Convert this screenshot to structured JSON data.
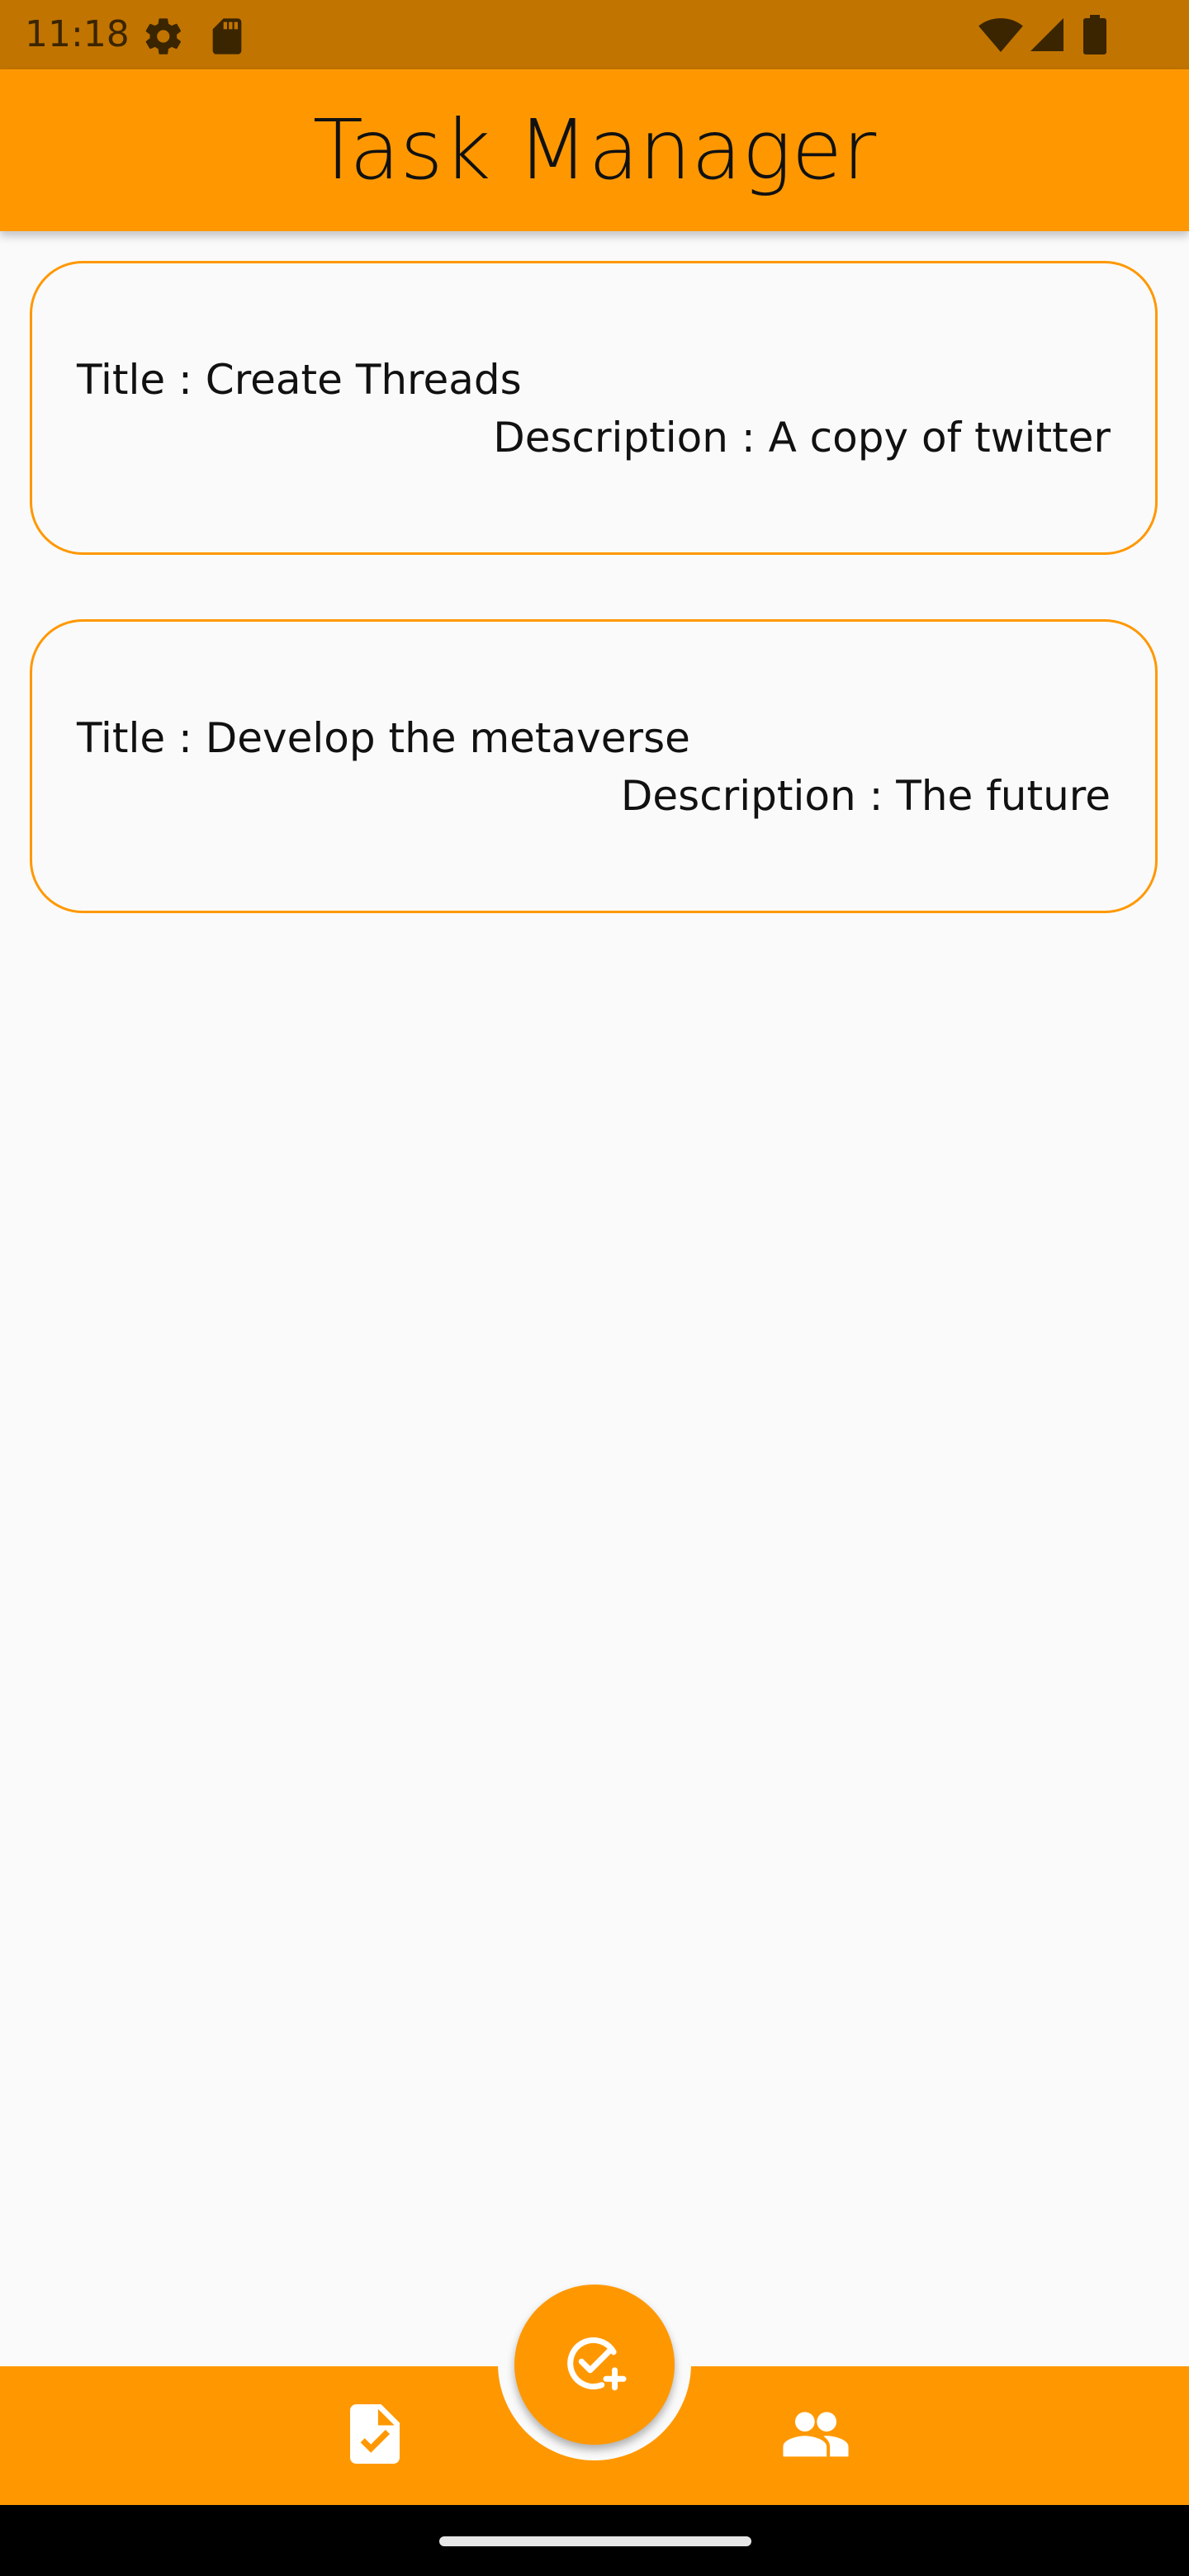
{
  "status_bar": {
    "time": "11:18",
    "icons": [
      "settings-gear-icon",
      "sd-card-icon",
      "wifi-icon",
      "cell-signal-icon",
      "battery-icon"
    ]
  },
  "app_bar": {
    "title": "Task Manager"
  },
  "tasks": [
    {
      "title": "Title : Create Threads",
      "description": "Description : A copy of twitter"
    },
    {
      "title": "Title : Develop the metaverse",
      "description": "Description : The future"
    }
  ],
  "fab": {
    "icon": "add-task-icon"
  },
  "bottom_nav": {
    "items": [
      {
        "icon": "task-document-icon"
      },
      {
        "icon": "people-icon"
      }
    ]
  },
  "colors": {
    "primary": "#ff9800",
    "status_bar": "#c17400",
    "background": "#fafafa",
    "text": "#111111"
  }
}
